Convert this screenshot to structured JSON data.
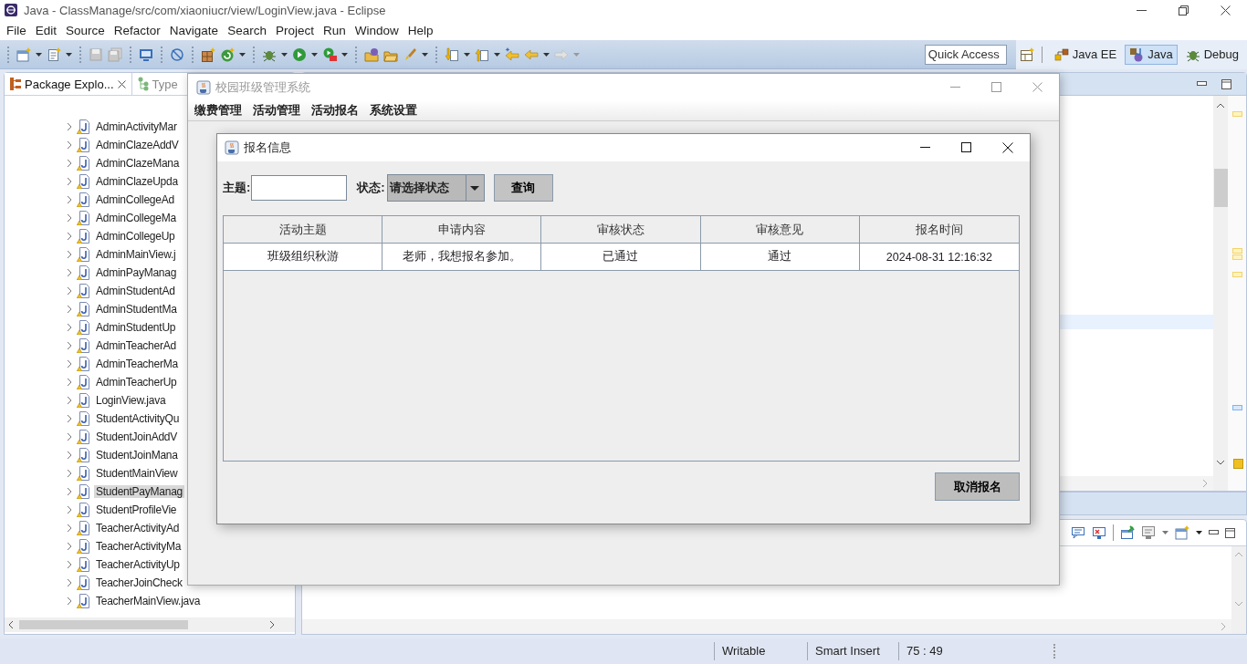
{
  "window": {
    "title": "Java - ClassManage/src/com/xiaoniucr/view/LoginView.java - Eclipse"
  },
  "menu": [
    "File",
    "Edit",
    "Source",
    "Refactor",
    "Navigate",
    "Search",
    "Project",
    "Run",
    "Window",
    "Help"
  ],
  "toolbar": {
    "quick_access": {
      "placeholder": "Quick Access"
    },
    "perspectives": [
      {
        "label": "Java EE",
        "selected": false
      },
      {
        "label": "Java",
        "selected": true
      },
      {
        "label": "Debug",
        "selected": false
      }
    ]
  },
  "explorer": {
    "tabs": [
      {
        "label": "Package Explo...",
        "selected": true
      },
      {
        "label": "Type",
        "selected": false
      }
    ],
    "items": [
      {
        "label": "AdminActivityMar",
        "selected": false
      },
      {
        "label": "AdminClazeAddV",
        "selected": false
      },
      {
        "label": "AdminClazeMana",
        "selected": false
      },
      {
        "label": "AdminClazeUpda",
        "selected": false
      },
      {
        "label": "AdminCollegeAd",
        "selected": false
      },
      {
        "label": "AdminCollegeMa",
        "selected": false
      },
      {
        "label": "AdminCollegeUp",
        "selected": false
      },
      {
        "label": "AdminMainView.j",
        "selected": false
      },
      {
        "label": "AdminPayManag",
        "selected": false
      },
      {
        "label": "AdminStudentAd",
        "selected": false
      },
      {
        "label": "AdminStudentMa",
        "selected": false
      },
      {
        "label": "AdminStudentUp",
        "selected": false
      },
      {
        "label": "AdminTeacherAd",
        "selected": false
      },
      {
        "label": "AdminTeacherMa",
        "selected": false
      },
      {
        "label": "AdminTeacherUp",
        "selected": false
      },
      {
        "label": "LoginView.java",
        "selected": false
      },
      {
        "label": "StudentActivityQu",
        "selected": false
      },
      {
        "label": "StudentJoinAddV",
        "selected": false
      },
      {
        "label": "StudentJoinMana",
        "selected": false
      },
      {
        "label": "StudentMainView",
        "selected": false
      },
      {
        "label": "StudentPayManag",
        "selected": true
      },
      {
        "label": "StudentProfileVie",
        "selected": false
      },
      {
        "label": "TeacherActivityAd",
        "selected": false
      },
      {
        "label": "TeacherActivityMa",
        "selected": false
      },
      {
        "label": "TeacherActivityUp",
        "selected": false
      },
      {
        "label": "TeacherJoinCheck",
        "selected": false
      },
      {
        "label": "TeacherMainView.java",
        "selected": false
      }
    ]
  },
  "status_bar": [
    "Writable",
    "Smart Insert",
    "75 : 49"
  ],
  "app_window": {
    "title": "校园班级管理系统",
    "menu": [
      "缴费管理",
      "活动管理",
      "活动报名",
      "系统设置"
    ]
  },
  "dialog": {
    "title": "报名信息",
    "filters": {
      "topic_label": "主题:",
      "status_label": "状态:",
      "status_value": "请选择状态",
      "query_button": "查询"
    },
    "table": {
      "columns": [
        "活动主题",
        "申请内容",
        "审核状态",
        "审核意见",
        "报名时间"
      ],
      "rows": [
        [
          "班级组织秋游",
          "老师，我想报名参加。",
          "已通过",
          "通过",
          "2024-08-31 12:16:32"
        ]
      ]
    },
    "buttons": [
      "取消报名"
    ]
  }
}
